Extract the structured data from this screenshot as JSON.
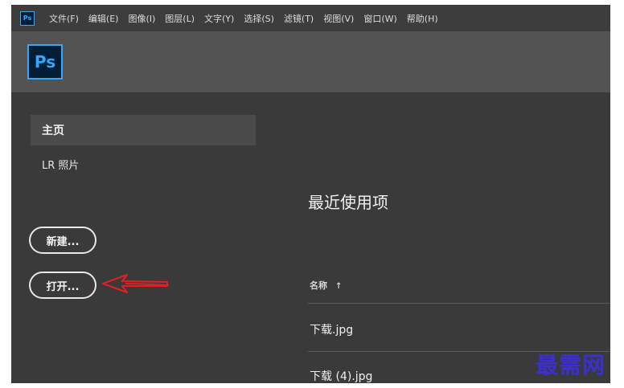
{
  "menubar": {
    "logo": "Ps",
    "items": [
      "文件(F)",
      "编辑(E)",
      "图像(I)",
      "图层(L)",
      "文字(Y)",
      "选择(S)",
      "滤镜(T)",
      "视图(V)",
      "窗口(W)",
      "帮助(H)"
    ]
  },
  "toolbar": {
    "logo": "Ps"
  },
  "sidebar": {
    "home": "主页",
    "lr_photos": "LR 照片",
    "new_button": "新建...",
    "open_button": "打开..."
  },
  "recent": {
    "title": "最近使用项",
    "column_name": "名称",
    "sort_icon": "↑",
    "files": [
      "下载.jpg",
      "下载 (4).jpg"
    ]
  },
  "watermark": "最需网",
  "colors": {
    "accent": "#31a8ff",
    "annotation_arrow": "#e02020"
  }
}
